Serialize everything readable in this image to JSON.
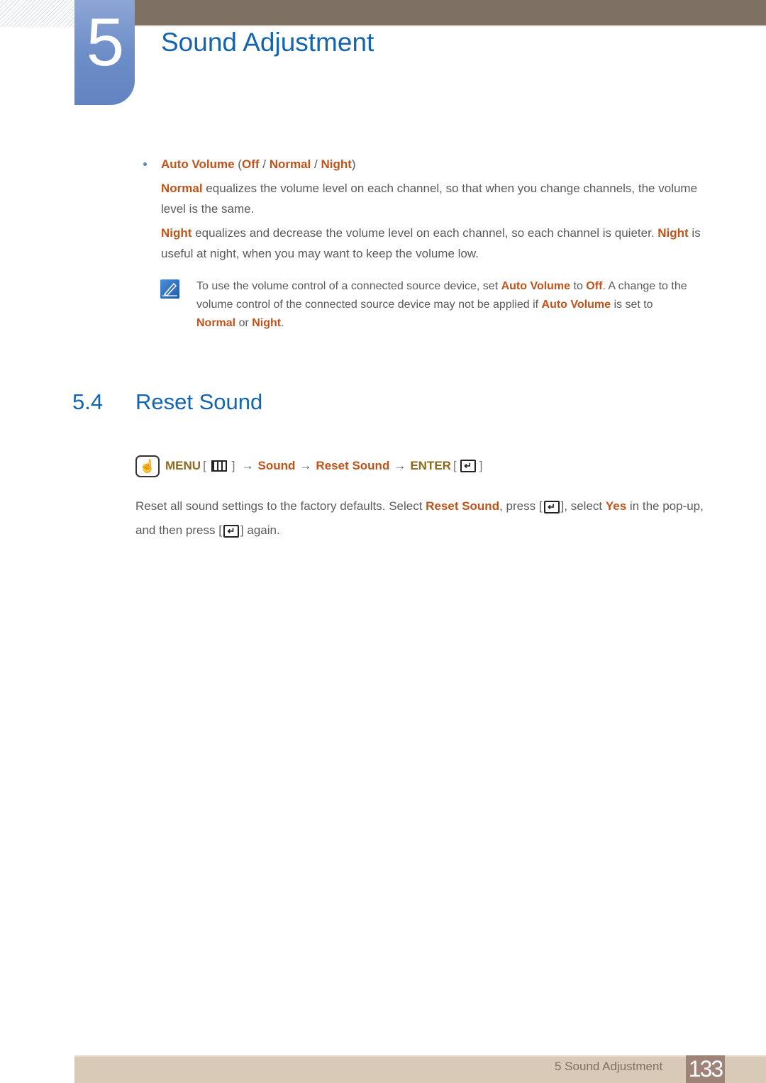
{
  "header": {
    "chapter_number": "5",
    "chapter_title": "Sound Adjustment"
  },
  "auto_volume": {
    "label": "Auto Volume",
    "open_paren": " (",
    "options": [
      "Off",
      "Normal",
      "Night"
    ],
    "separator": " / ",
    "close_paren": ")",
    "normal_desc": {
      "term": "Normal",
      "text": " equalizes the volume level on each channel, so that when you change channels, the volume level is the same."
    },
    "night_desc": {
      "term": "Night",
      "text1": " equalizes and decrease the volume level on each channel, so each channel is quieter. ",
      "term2": "Night",
      "text2": " is useful at night, when you may want to keep the volume low."
    },
    "note": {
      "icon": "note-pencil-icon",
      "t1": "To use the volume control of a connected source device, set ",
      "h1": "Auto Volume",
      "t2": " to ",
      "h2": "Off",
      "t3": ". A change to the volume control of the connected source device may not be applied if ",
      "h3": "Auto Volume",
      "t4": " is set to ",
      "h4": "Normal",
      "t5": " or ",
      "h5": "Night",
      "t6": "."
    }
  },
  "section": {
    "number": "5.4",
    "title": "Reset Sound"
  },
  "menu_path": {
    "remote_icon": "remote-hand-icon",
    "menu": "MENU",
    "bracket_open": "[",
    "bracket_close": "]",
    "arrow": "→",
    "step1": "Sound",
    "step2": "Reset Sound",
    "enter": "ENTER",
    "enter_glyph": "↵"
  },
  "body": {
    "t1": "Reset all sound settings to the factory defaults. Select ",
    "h1": "Reset Sound",
    "t2": ", press [",
    "t3": "], select ",
    "h2": "Yes",
    "t4": " in the pop-up, and then press [",
    "t5": "] again.",
    "enter_glyph": "↵"
  },
  "footer": {
    "label": "5 Sound Adjustment",
    "page_number": "133"
  },
  "colors": {
    "heading_blue": "#1464b0",
    "highlight_orange": "#c0531a",
    "menu_gold": "#8a6a1e",
    "top_bar": "#7e7063",
    "footer_bar": "#d9cab7",
    "page_badge": "#9e8478"
  }
}
